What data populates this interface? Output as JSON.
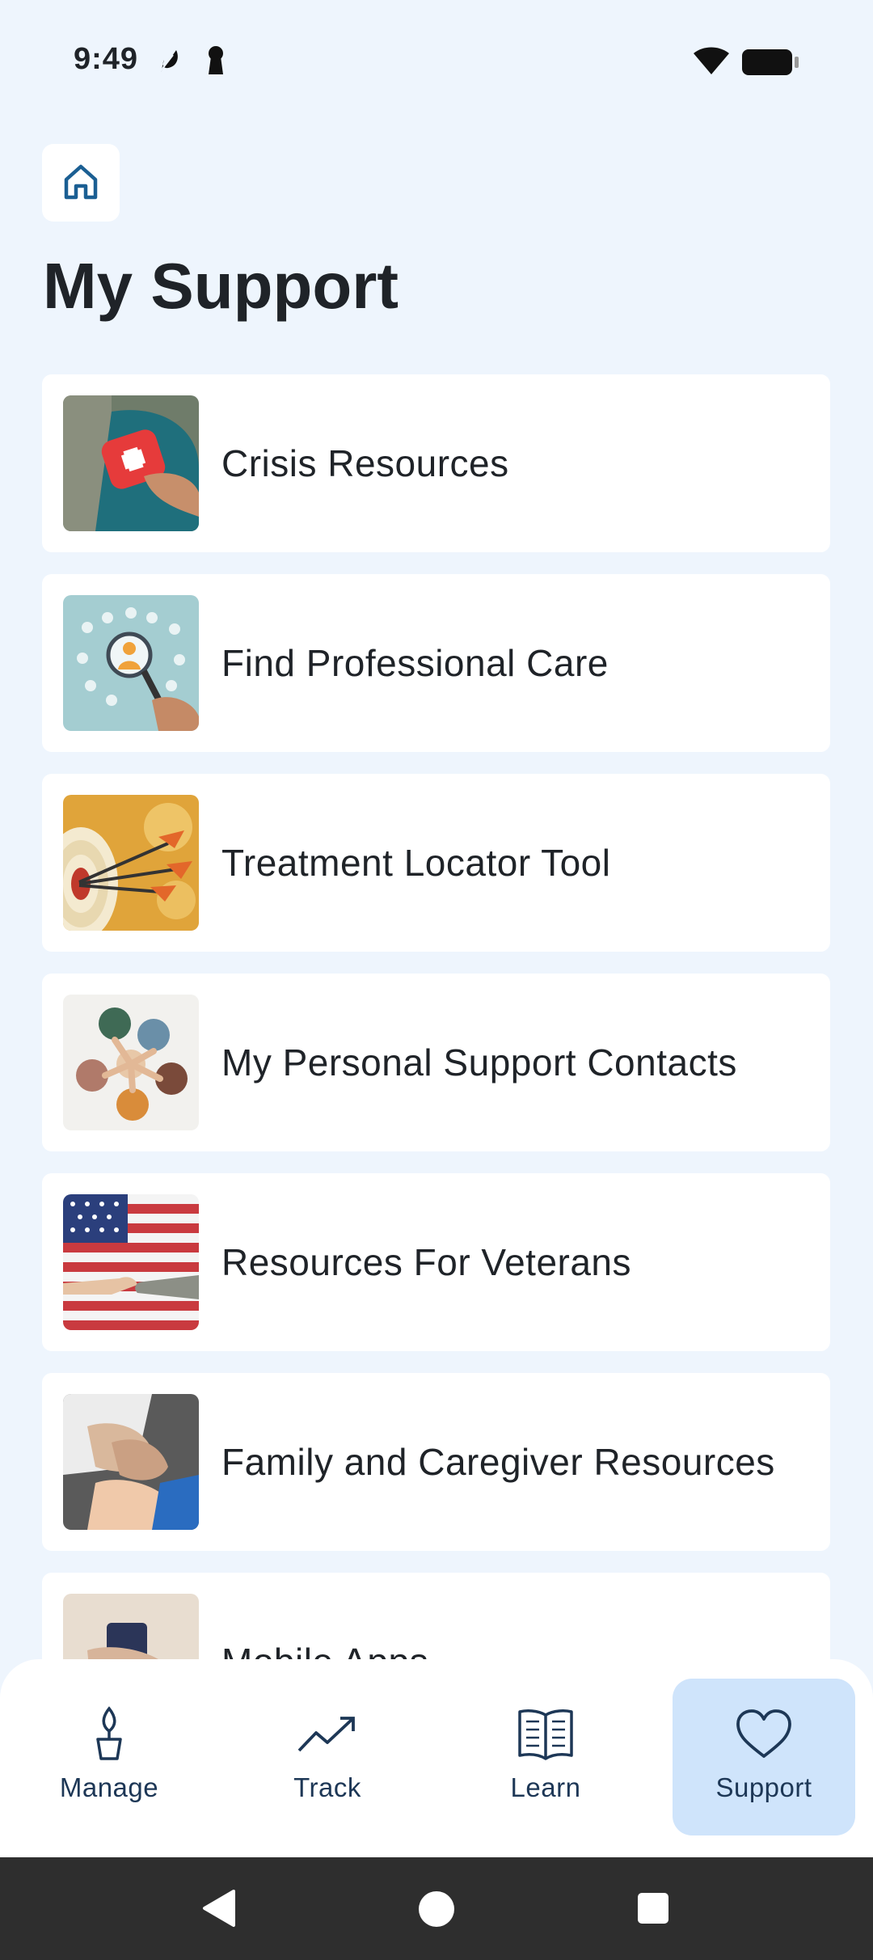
{
  "status_bar": {
    "time": "9:49"
  },
  "header": {
    "title": "My Support"
  },
  "support_items": [
    {
      "label": "Crisis Resources"
    },
    {
      "label": "Find Professional Care"
    },
    {
      "label": "Treatment Locator Tool"
    },
    {
      "label": "My Personal Support Contacts"
    },
    {
      "label": "Resources For Veterans"
    },
    {
      "label": "Family and Caregiver Resources"
    },
    {
      "label": "Mobile Apps"
    }
  ],
  "bottom_nav": {
    "items": [
      {
        "label": "Manage",
        "icon": "plant-icon"
      },
      {
        "label": "Track",
        "icon": "trend-icon"
      },
      {
        "label": "Learn",
        "icon": "book-icon"
      },
      {
        "label": "Support",
        "icon": "heart-icon"
      }
    ],
    "active": "Support"
  },
  "colors": {
    "background": "#eef5fd",
    "card": "#ffffff",
    "accent": "#1b5f93",
    "nav_active": "#cfe4fb",
    "nav_text": "#1d3756"
  }
}
